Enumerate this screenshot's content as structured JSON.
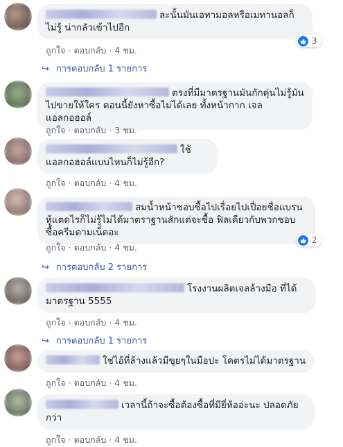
{
  "comments": [
    {
      "text": "ละนั้นมันเอทามอลหรือเมทานอลก็ไม่รู้ น่ากลัวเข้าไปอีก",
      "like": "ถูกใจ",
      "reply": "ตอบกลับ",
      "time": "4 ชม.",
      "reactions": "3",
      "replies": "การตอบกลับ 1 รายการ"
    },
    {
      "text": "ตรงที่มีมาตรฐานมันกักตุ่นไม่รู้มันไปขายให้ใคร ตอนนี้ยังหาซื้อไม่ได้เลย ทั้งหน้ากาก เจล แอลกอฮอล์",
      "like": "ถูกใจ",
      "reply": "ตอบกลับ",
      "time": "3 ชม."
    },
    {
      "text": "ใช้แอลกอฮอล์แบบไหนก็ไม่รู้อีก?",
      "like": "ถูกใจ",
      "reply": "ตอบกลับ",
      "time": "4 ชม."
    },
    {
      "text": "สมน้ำหน้าชอบซื้อไปเรื่อยไปเปื่อยชื่อแบรนหู้แตดไรก็ไม่รู้ไม่ได้มาตราฐานสักแต่จะซื้อ ฟิลเดียวกับพวกชอบซื้อครีมตามเน็ตอะ",
      "like": "ถูกใจ",
      "reply": "ตอบกลับ",
      "time": "4 ชม.",
      "reactions": "2",
      "replies": "การตอบกลับ 2 รายการ"
    },
    {
      "text": "โรงงานผลิตเจลล้างมือ ที่ได้มาตรฐาน 5555",
      "like": "ถูกใจ",
      "reply": "ตอบกลับ",
      "time": "4 ชม.",
      "replies": "การตอบกลับ 1 รายการ"
    },
    {
      "text": "ใช่ไอ้ที่ล้างแล้วมีขุยๆในมือปะ โคตรไม่ได้มาตรฐาน",
      "like": "ถูกใจ",
      "reply": "ตอบกลับ",
      "time": "4 ชม."
    },
    {
      "text": "เวลานี้ถ้าจะซื้อต้องซื้อที่มียี่ห้ออ่ะนะ ปลอดภัยกว่า",
      "like": "ถูกใจ",
      "reply": "ตอบกลับ",
      "time": "4 ชม."
    }
  ],
  "colors": {
    "bubble": "#f2f3f5",
    "link": "#385898",
    "meta": "#616770",
    "like_blue": "#1877f2"
  },
  "icons": {
    "reply_arrow": "reply-arrow-icon",
    "like": "thumbs-up-icon"
  }
}
